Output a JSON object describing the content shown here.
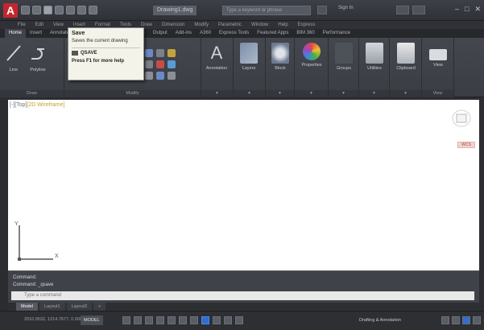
{
  "titlebar": {
    "window_title": "Drawing1.dwg",
    "search_placeholder": "Type a keyword or phrase",
    "signin": "Sign In"
  },
  "menubar": [
    "File",
    "Edit",
    "View",
    "Insert",
    "Format",
    "Tools",
    "Draw",
    "Dimension",
    "Modify",
    "Parametric",
    "Window",
    "Help",
    "Express"
  ],
  "ribbon_tabs": [
    {
      "label": "Home",
      "active": true
    },
    {
      "label": "Insert",
      "active": false
    },
    {
      "label": "Annotate",
      "active": false
    },
    {
      "label": "Parametric",
      "active": false
    },
    {
      "label": "View",
      "active": false
    },
    {
      "label": "Manage",
      "active": false
    },
    {
      "label": "Output",
      "active": false
    },
    {
      "label": "Add-ins",
      "active": false
    },
    {
      "label": "A360",
      "active": false
    },
    {
      "label": "Express Tools",
      "active": false
    },
    {
      "label": "Featured Apps",
      "active": false
    },
    {
      "label": "BIM 360",
      "active": false
    },
    {
      "label": "Performance",
      "active": false
    }
  ],
  "ribbon": {
    "draw_panel_title": "Draw",
    "modify_panel_title": "Modify",
    "line_label": "Line",
    "polyline_label": "Polyline",
    "annotation_label": "Annotation",
    "layers_label": "Layers",
    "block_label": "Block",
    "properties_label": "Properties",
    "groups_label": "Groups",
    "utilities_label": "Utilities",
    "clipboard_label": "Clipboard",
    "view_label": "View",
    "view_panel_title": "View"
  },
  "tooltip": {
    "title": "Save",
    "description": "Saves the current drawing",
    "command": "QSAVE",
    "help": "Press F1 for more help"
  },
  "viewport": {
    "label_prefix": "[-][Top]",
    "label_style": "[2D Wireframe]",
    "wcs": "WCS"
  },
  "command": {
    "history_1": "Command:",
    "history_2": "Command: _qsave",
    "input_placeholder": "Type a command"
  },
  "layout_tabs": [
    {
      "label": "Model",
      "active": true
    },
    {
      "label": "Layout1",
      "active": false
    },
    {
      "label": "Layout2",
      "active": false
    },
    {
      "label": "+",
      "active": false
    }
  ],
  "statusbar": {
    "coords": "2010.9532, 1214.7677, 0.0000",
    "model": "MODEL",
    "workspace": "Drafting & Annotation"
  },
  "colors": {
    "app_logo": "#c4262e",
    "accent_blue": "#2f6fcf"
  }
}
